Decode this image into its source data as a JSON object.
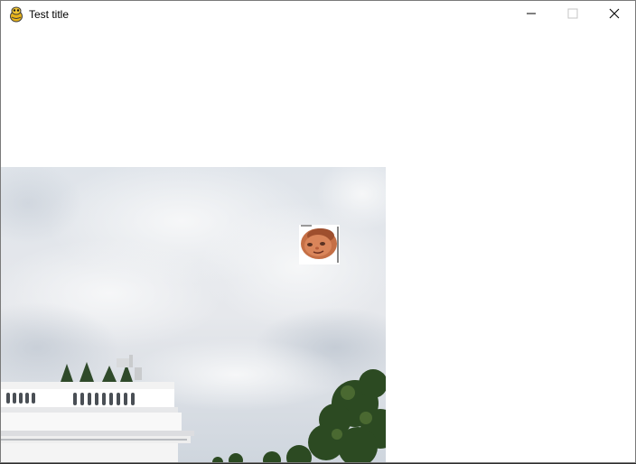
{
  "window": {
    "title": "Test title",
    "app_icon": "pygame-snake-icon",
    "controls": {
      "minimize_icon": "minimize-icon",
      "maximize_icon": "maximize-icon",
      "close_icon": "close-icon"
    }
  },
  "canvas": {
    "background": "#ffffff",
    "scene_image": "white-house-roof-and-cloudy-sky",
    "sprite": "face-sprite"
  }
}
